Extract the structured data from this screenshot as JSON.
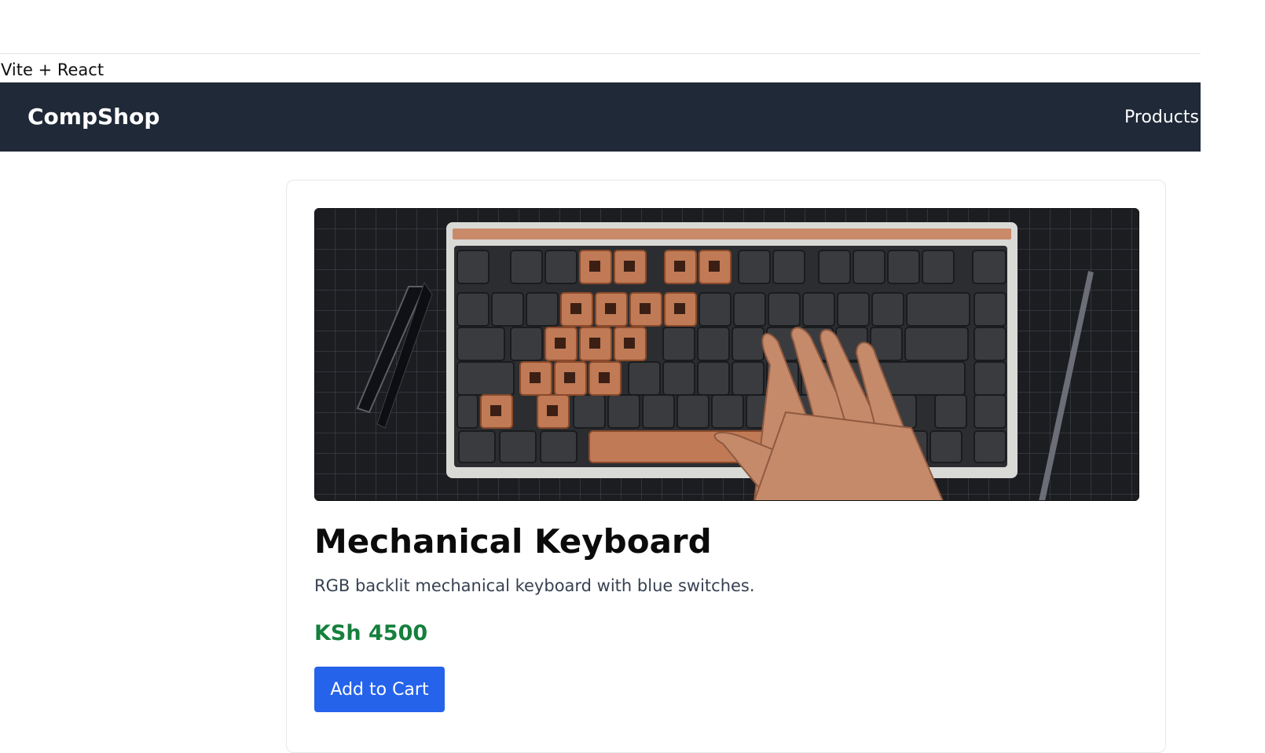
{
  "document": {
    "title": "Vite + React"
  },
  "navbar": {
    "brand": "CompShop",
    "links": [
      {
        "label": "Products"
      }
    ],
    "background": "#1f2937"
  },
  "product": {
    "image_alt": "mechanical keyboard photo",
    "name": "Mechanical Keyboard",
    "description": "RGB backlit mechanical keyboard with blue switches.",
    "price": "KSh 4500",
    "add_to_cart_label": "Add to Cart",
    "colors": {
      "price": "#15803d",
      "button": "#2563eb"
    }
  }
}
